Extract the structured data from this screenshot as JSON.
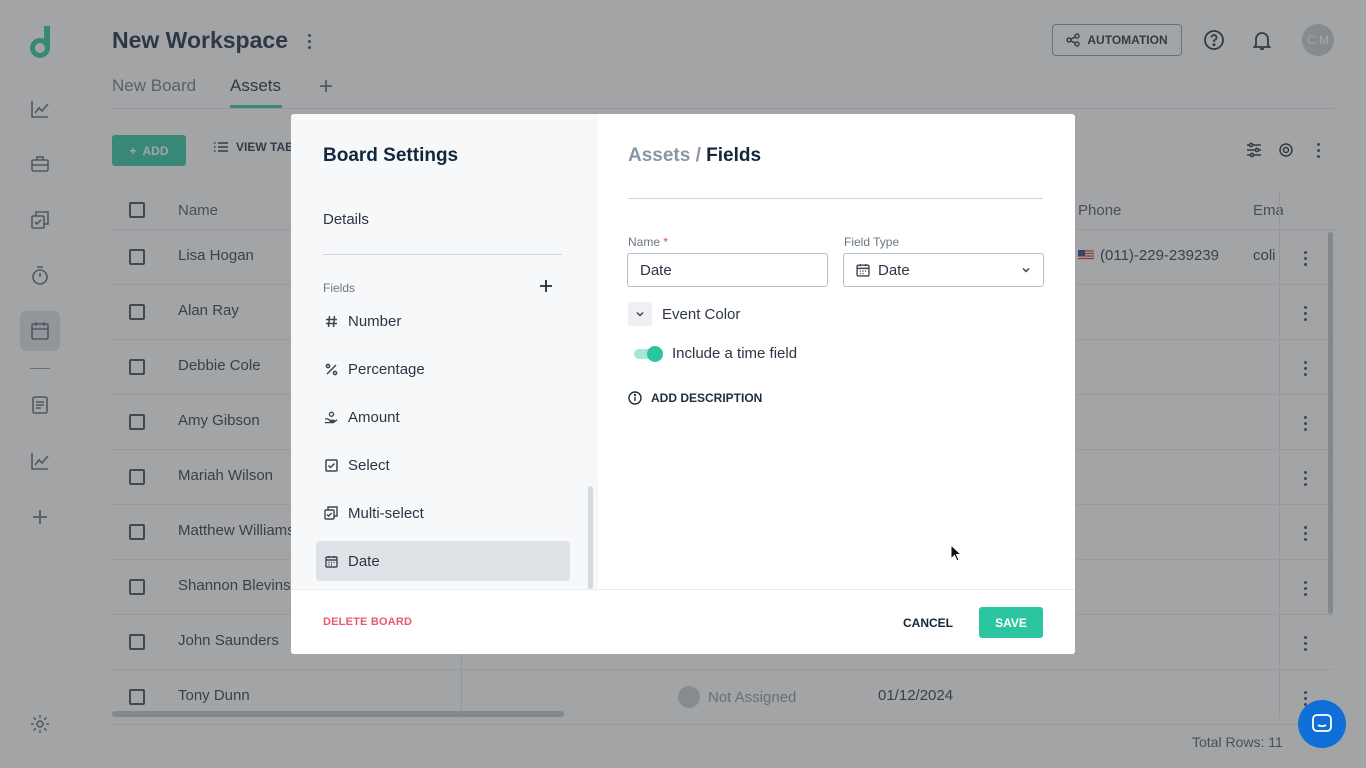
{
  "workspace": {
    "title": "New Workspace"
  },
  "tabs": [
    {
      "label": "New Board"
    },
    {
      "label": "Assets"
    }
  ],
  "topbar": {
    "automation_label": "AUTOMATION",
    "avatar_initials": "C M"
  },
  "toolbar": {
    "add_label": "ADD",
    "view_label": "VIEW TAB"
  },
  "grid": {
    "columns": {
      "name": "Name",
      "phone": "Phone",
      "email": "Ema"
    },
    "rows": [
      {
        "name": "Lisa Hogan",
        "phone": "(011)-229-239239",
        "email": "coli"
      },
      {
        "name": "Alan Ray"
      },
      {
        "name": "Debbie Cole"
      },
      {
        "name": "Amy Gibson"
      },
      {
        "name": "Mariah Wilson"
      },
      {
        "name": "Matthew Williams"
      },
      {
        "name": "Shannon Blevins"
      },
      {
        "name": "John Saunders"
      },
      {
        "name": "Tony Dunn",
        "assignee": "Not Assigned",
        "date": "01/12/2024"
      }
    ],
    "total_rows": "Total Rows: 11"
  },
  "modal": {
    "title": "Board Settings",
    "details_label": "Details",
    "fields_label": "Fields",
    "field_types": [
      {
        "label": "Number",
        "icon": "hash-icon"
      },
      {
        "label": "Percentage",
        "icon": "percent-icon"
      },
      {
        "label": "Amount",
        "icon": "coins-hand-icon"
      },
      {
        "label": "Select",
        "icon": "checkbox-icon"
      },
      {
        "label": "Multi-select",
        "icon": "multi-checkbox-icon"
      },
      {
        "label": "Date",
        "icon": "calendar-icon",
        "selected": true
      }
    ],
    "breadcrumb": {
      "board": "Assets",
      "separator": " / ",
      "section": "Fields"
    },
    "name_label": "Name",
    "name_required": "*",
    "name_value": "Date",
    "field_type_label": "Field Type",
    "field_type_value": "Date",
    "event_color_label": "Event Color",
    "include_time_label": "Include a time field",
    "include_time_on": true,
    "add_description_label": "ADD DESCRIPTION",
    "delete_label": "DELETE BOARD",
    "cancel_label": "CANCEL",
    "save_label": "SAVE"
  },
  "colors": {
    "accent": "#2bc5a0",
    "danger": "#e85a6b",
    "brand_dark": "#13263b"
  }
}
